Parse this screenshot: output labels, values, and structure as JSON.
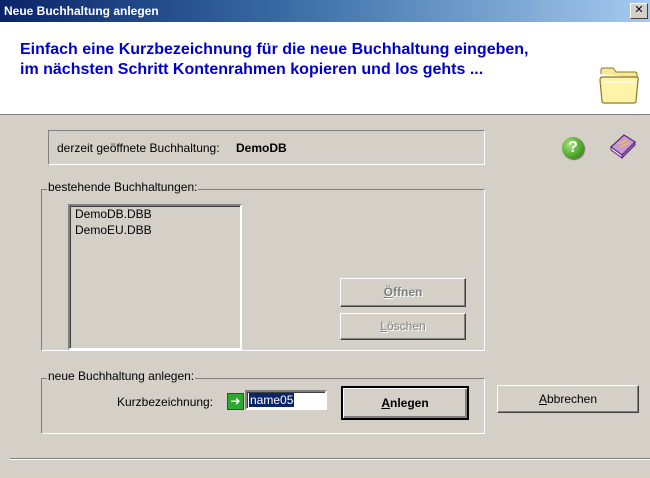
{
  "window": {
    "title": "Neue Buchhaltung anlegen",
    "close_glyph": "✕"
  },
  "header": {
    "line1": "Einfach eine Kurzbezeichnung für die neue Buchhaltung eingeben,",
    "line2": "im nächsten Schritt Kontenrahmen kopieren und los gehts ...",
    "icon": "folder-icon"
  },
  "current": {
    "label": "derzeit geöffnete Buchhaltung:",
    "value": "DemoDB"
  },
  "icons": {
    "help": "?",
    "help_icon": "help-icon",
    "book_icon": "book-icon"
  },
  "existing": {
    "label": "bestehende Buchhaltungen:",
    "items": [
      "DemoDB.DBB",
      "DemoEU.DBB"
    ],
    "open_button": {
      "access": "Ö",
      "rest": "ffnen"
    },
    "delete_button": {
      "access": "L",
      "rest": "öschen"
    }
  },
  "create": {
    "label": "neue Buchhaltung anlegen:",
    "field_label": "Kurzbezeichnung:",
    "field_value": "name05",
    "create_button": {
      "access": "A",
      "rest": "nlegen"
    }
  },
  "cancel_button": {
    "access": "A",
    "rest": "bbrechen"
  },
  "colors": {
    "title_bar": "#0a246a",
    "header_text": "#0000cc",
    "dialog_bg": "#d4d0c8"
  }
}
